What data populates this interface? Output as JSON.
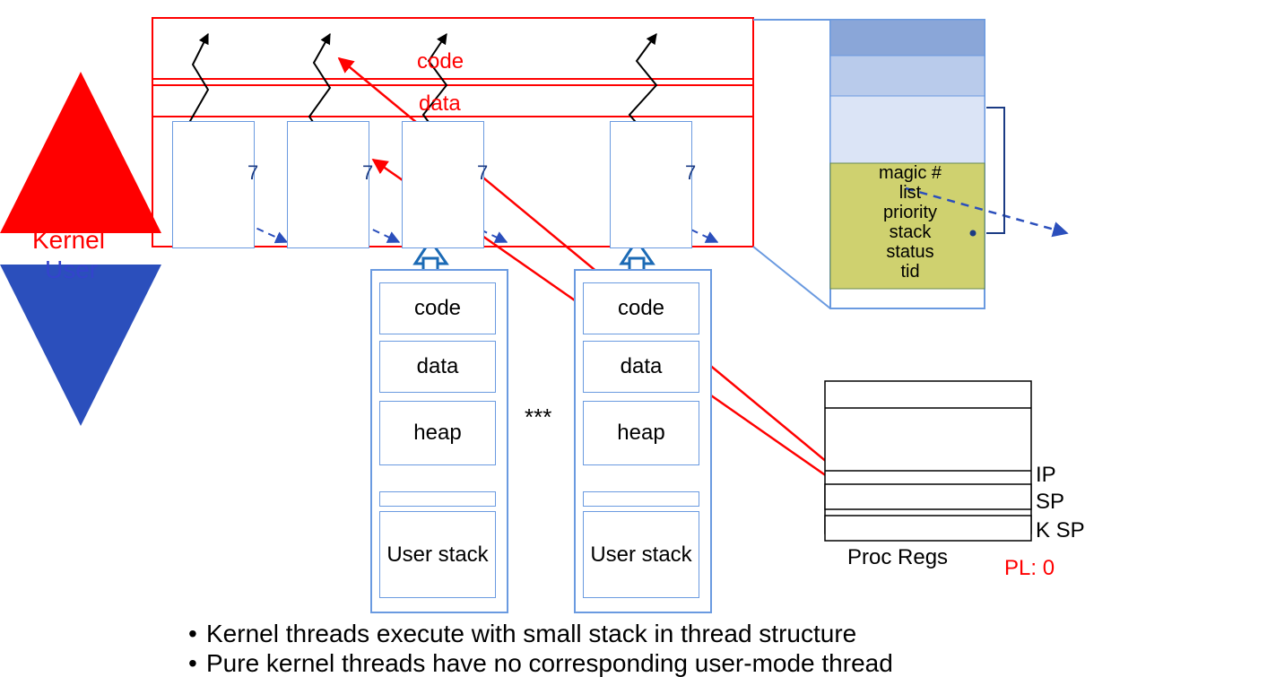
{
  "labels": {
    "kernel": "Kernel",
    "user": "User",
    "code": "code",
    "data": "data",
    "heap": "heap",
    "userstack": "User\nstack",
    "proc_regs": "Proc Regs",
    "ip": "IP",
    "sp": "SP",
    "ksp": "K SP",
    "pl": "PL: 0",
    "threadnum": "7",
    "asterisks": "***"
  },
  "zoom_fields": {
    "l1": "magic #",
    "l2": "list",
    "l3": "priority",
    "l4": "stack",
    "l5": "status",
    "l6": "tid"
  },
  "bullets": {
    "b1": "Kernel threads execute with small stack in thread structure",
    "b2": "Pure kernel threads have no corresponding user-mode thread"
  },
  "colors": {
    "red": "#ff0000",
    "blue": "#3355cc",
    "box_blue": "#6a9ae0",
    "zoom_yellow": "#cfd16f",
    "zoom_light": "#dbe4f6",
    "zoom_mid": "#b9cbeb",
    "zoom_dark": "#8aa6d8"
  }
}
